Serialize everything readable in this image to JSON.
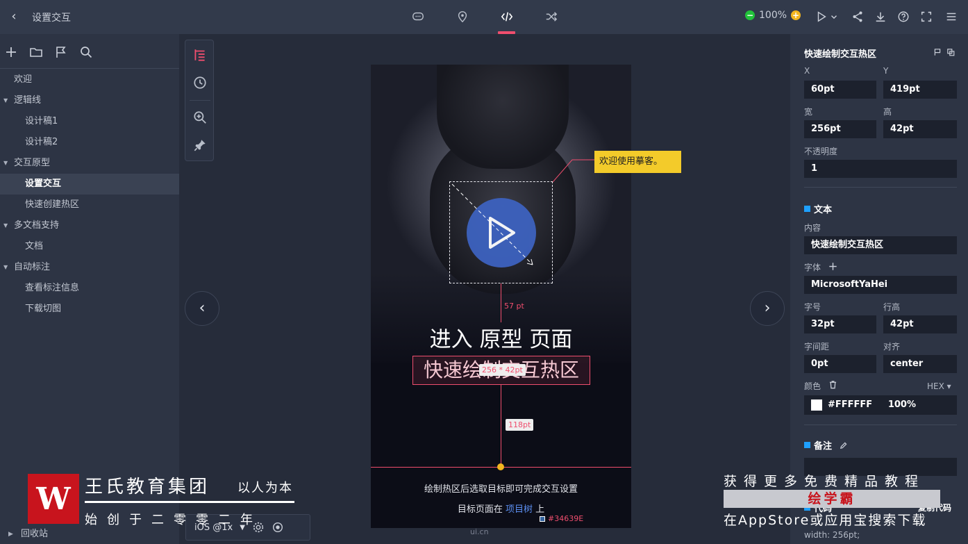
{
  "topbar": {
    "title": "设置交互",
    "zoom": "100%",
    "modes": [
      "comment-icon",
      "location-icon",
      "code-icon",
      "shuffle-icon"
    ],
    "active_mode": "code-icon",
    "accent": "#f04e6e"
  },
  "sidebar": {
    "items": [
      {
        "label": "欢迎",
        "level": 0,
        "caret": false
      },
      {
        "label": "逻辑线",
        "level": 0,
        "caret": true
      },
      {
        "label": "设计稿1",
        "level": 1
      },
      {
        "label": "设计稿2",
        "level": 1
      },
      {
        "label": "交互原型",
        "level": 0,
        "caret": true
      },
      {
        "label": "设置交互",
        "level": 1,
        "active": true
      },
      {
        "label": "快速创建热区",
        "level": 1
      },
      {
        "label": "多文档支持",
        "level": 0,
        "caret": true
      },
      {
        "label": "文档",
        "level": 1
      },
      {
        "label": "自动标注",
        "level": 0,
        "caret": true
      },
      {
        "label": "查看标注信息",
        "level": 1
      },
      {
        "label": "下载切图",
        "level": 1
      }
    ],
    "recycle": "回收站"
  },
  "canvas": {
    "device_title": "进入 原型 页面",
    "hotspot_text": "快速绘制交互热区",
    "hotspot_size": "256 * 42pt",
    "dist_top": "57 pt",
    "dist_bottom": "118pt",
    "tooltip": "欢迎使用摹客。",
    "sub1": "绘制热区后选取目标即可完成交互设置",
    "sub2_pre": "目标页面在",
    "sub2_link": "项目树",
    "sub2_post": "上",
    "color_chip": "#34639E",
    "device_mark": "ui.cn",
    "device_select": "iOS @1x"
  },
  "props": {
    "header": "快速绘制交互热区",
    "x_label": "X",
    "x": "60pt",
    "y_label": "Y",
    "y": "419pt",
    "w_label": "宽",
    "w": "256pt",
    "h_label": "高",
    "h": "42pt",
    "opacity_label": "不透明度",
    "opacity": "1",
    "text_section": "文本",
    "content_label": "内容",
    "content": "快速绘制交互热区",
    "font_label": "字体",
    "font": "MicrosoftYaHei",
    "size_label": "字号",
    "size": "32pt",
    "lh_label": "行高",
    "lh": "42pt",
    "ls_label": "字间距",
    "ls": "0pt",
    "align_label": "对齐",
    "align": "center",
    "color_label": "颜色",
    "color_format": "HEX",
    "color": "#FFFFFF",
    "color_opacity": "100%",
    "note_section": "备注",
    "code_section": "代码",
    "copy_code": "复制代码",
    "width_code": "width: 256pt;"
  },
  "watermark": {
    "logo": "W",
    "main": "王氏教育集团",
    "tag": "以人为本",
    "sub": "始创于二零零二年",
    "r1": "获得更多免费精品教程",
    "r2": "绘学霸",
    "r3": "在AppStore或应用宝搜索下载"
  }
}
